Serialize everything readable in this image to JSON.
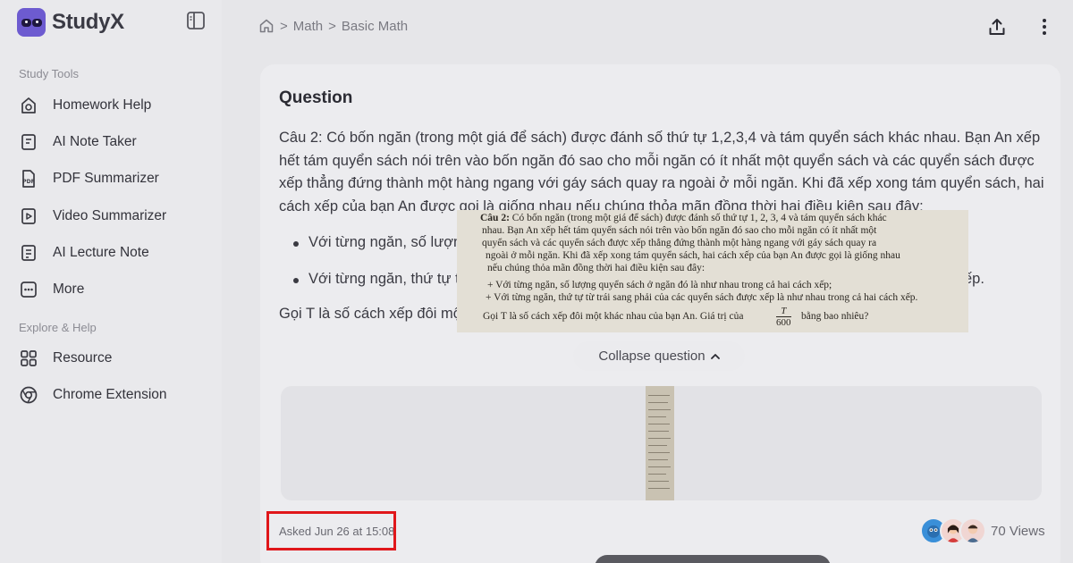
{
  "app": {
    "name": "StudyX"
  },
  "sidebar": {
    "sections": [
      {
        "title": "Study Tools",
        "items": [
          {
            "label": "Homework Help",
            "icon": "homework-icon"
          },
          {
            "label": "AI Note Taker",
            "icon": "note-icon"
          },
          {
            "label": "PDF Summarizer",
            "icon": "pdf-icon"
          },
          {
            "label": "Video Summarizer",
            "icon": "video-icon"
          },
          {
            "label": "AI Lecture Note",
            "icon": "lecture-icon"
          },
          {
            "label": "More",
            "icon": "more-icon"
          }
        ]
      },
      {
        "title": "Explore & Help",
        "items": [
          {
            "label": "Resource",
            "icon": "grid-icon"
          },
          {
            "label": "Chrome Extension",
            "icon": "chrome-icon"
          }
        ]
      }
    ]
  },
  "breadcrumb": {
    "sep": ">",
    "items": [
      "Math",
      "Basic Math"
    ]
  },
  "question": {
    "title": "Question",
    "text": "Câu 2: Có bốn ngăn (trong một giá để sách) được đánh số thứ tự 1,2,3,4 và tám quyển sách khác nhau. Bạn An xếp hết tám quyển sách nói trên vào bốn ngăn đó sao cho mỗi ngăn có ít nhất một quyển sách và các quyển sách được xếp thẳng đứng thành một hàng ngang với gáy sách quay ra ngoài ở mỗi ngăn. Khi đã xếp xong tám quyển sách, hai cách xếp của bạn An được gọi là giống nhau nếu chúng thỏa mãn đồng thời hai điều kiện sau đây:",
    "bullets": [
      "Với từng ngăn, số lượng",
      "Với từng ngăn, thứ tự t"
    ],
    "bullet_tail": "ếp.",
    "last": "Gọi T là số cách xếp đôi mộ",
    "collapse_label": "Collapse question",
    "asked": "Asked Jun 26 at 15:08",
    "views": "70 Views"
  },
  "scan": {
    "lines": [
      {
        "b": "Câu 2:",
        "t": " Có bốn ngăn (trong một giá để sách) được đánh số thứ tự  1, 2, 3, 4  và tám quyển sách khác"
      },
      {
        "t": "nhau. Bạn An xếp hết tám quyển sách nói trên vào bốn ngăn đó sao cho mỗi ngăn có ít nhất một"
      },
      {
        "t": "quyển sách và các quyển sách được xếp thẳng đứng thành một hàng ngang với gáy sách quay ra"
      },
      {
        "t": "ngoài ở mỗi ngăn. Khi đã xếp xong tám quyển sách, hai cách xếp của bạn An được gọi là giống nhau"
      },
      {
        "t": "nếu chúng thỏa mãn đồng thời hai điều kiện sau đây:"
      },
      {
        "t": "+ Với từng ngăn, số lượng quyển sách ở ngăn đó là như nhau trong cả hai cách xếp;"
      },
      {
        "t": "+ Với từng ngăn, thứ tự từ trái sang phải của các quyển sách được xếp là như nhau trong cả hai cách xếp."
      },
      {
        "t": "Gọi  T  là số cách xếp đôi một khác nhau của bạn An. Giá trị của"
      },
      {
        "t": "bằng bao nhiêu?"
      }
    ],
    "frac_num": "T",
    "frac_den": "600"
  }
}
